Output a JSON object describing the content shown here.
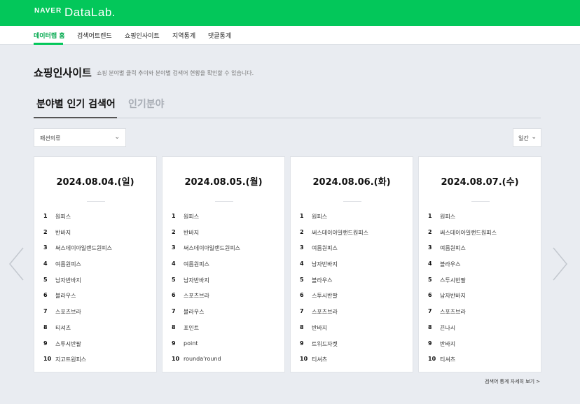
{
  "header": {
    "brand": "NAVER",
    "product": "DataLab."
  },
  "nav": {
    "items": [
      {
        "label": "데이터랩 홈",
        "active": true
      },
      {
        "label": "검색어트렌드",
        "active": false
      },
      {
        "label": "쇼핑인사이트",
        "active": false
      },
      {
        "label": "지역통계",
        "active": false
      },
      {
        "label": "댓글통계",
        "active": false
      }
    ]
  },
  "page": {
    "title": "쇼핑인사이트",
    "description": "쇼핑 분야별 클릭 추이와 분야별 검색어 현황을 확인할 수 있습니다."
  },
  "tabs": [
    {
      "label": "분야별 인기 검색어",
      "active": true
    },
    {
      "label": "인기분야",
      "active": false
    }
  ],
  "filters": {
    "category": "패션의류",
    "period": "일간"
  },
  "cards": [
    {
      "date": "2024.08.04.(일)",
      "items": [
        {
          "rank": "1",
          "keyword": "원피스"
        },
        {
          "rank": "2",
          "keyword": "반바지"
        },
        {
          "rank": "3",
          "keyword": "써스데이아일랜드원피스"
        },
        {
          "rank": "4",
          "keyword": "여름원피스"
        },
        {
          "rank": "5",
          "keyword": "남자반바지"
        },
        {
          "rank": "6",
          "keyword": "블라우스"
        },
        {
          "rank": "7",
          "keyword": "스포츠브라"
        },
        {
          "rank": "8",
          "keyword": "티셔츠"
        },
        {
          "rank": "9",
          "keyword": "스투시반팔"
        },
        {
          "rank": "10",
          "keyword": "지고트원피스"
        }
      ]
    },
    {
      "date": "2024.08.05.(월)",
      "items": [
        {
          "rank": "1",
          "keyword": "원피스"
        },
        {
          "rank": "2",
          "keyword": "반바지"
        },
        {
          "rank": "3",
          "keyword": "써스데이아일랜드원피스"
        },
        {
          "rank": "4",
          "keyword": "여름원피스"
        },
        {
          "rank": "5",
          "keyword": "남자반바지"
        },
        {
          "rank": "6",
          "keyword": "스포츠브라"
        },
        {
          "rank": "7",
          "keyword": "블라우스"
        },
        {
          "rank": "8",
          "keyword": "포인트"
        },
        {
          "rank": "9",
          "keyword": "point"
        },
        {
          "rank": "10",
          "keyword": "rounda'round"
        }
      ]
    },
    {
      "date": "2024.08.06.(화)",
      "items": [
        {
          "rank": "1",
          "keyword": "원피스"
        },
        {
          "rank": "2",
          "keyword": "써스데이아일랜드원피스"
        },
        {
          "rank": "3",
          "keyword": "여름원피스"
        },
        {
          "rank": "4",
          "keyword": "남자반바지"
        },
        {
          "rank": "5",
          "keyword": "블라우스"
        },
        {
          "rank": "6",
          "keyword": "스투시반팔"
        },
        {
          "rank": "7",
          "keyword": "스포츠브라"
        },
        {
          "rank": "8",
          "keyword": "반바지"
        },
        {
          "rank": "9",
          "keyword": "트위드자켓"
        },
        {
          "rank": "10",
          "keyword": "티셔츠"
        }
      ]
    },
    {
      "date": "2024.08.07.(수)",
      "items": [
        {
          "rank": "1",
          "keyword": "원피스"
        },
        {
          "rank": "2",
          "keyword": "써스데이아일랜드원피스"
        },
        {
          "rank": "3",
          "keyword": "여름원피스"
        },
        {
          "rank": "4",
          "keyword": "블라우스"
        },
        {
          "rank": "5",
          "keyword": "스투시반팔"
        },
        {
          "rank": "6",
          "keyword": "남자반바지"
        },
        {
          "rank": "7",
          "keyword": "스포츠브라"
        },
        {
          "rank": "8",
          "keyword": "끈나시"
        },
        {
          "rank": "9",
          "keyword": "반바지"
        },
        {
          "rank": "10",
          "keyword": "티셔츠"
        }
      ]
    }
  ],
  "more_link": "검색어 통계 자세히 보기 >",
  "icons": {
    "prev": "chevron-left-icon",
    "next": "chevron-right-icon",
    "dropdown": "chevron-down-icon"
  },
  "colors": {
    "brand_green": "#03c75a",
    "active_nav": "#03a94e",
    "page_bg": "#e9ecf1"
  }
}
